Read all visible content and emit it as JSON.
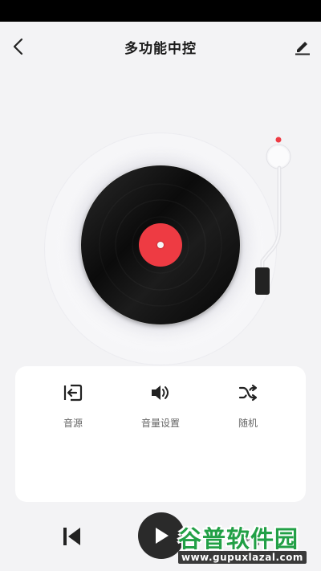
{
  "header": {
    "title": "多功能中控",
    "back_icon": "chevron-left-icon",
    "edit_icon": "pencil-icon"
  },
  "player": {
    "label_color": "#ee3b43",
    "record_color": "#111111"
  },
  "panel": {
    "items": [
      {
        "label": "音源",
        "icon": "input-source-icon"
      },
      {
        "label": "音量设置",
        "icon": "volume-icon"
      },
      {
        "label": "随机",
        "icon": "shuffle-icon"
      }
    ]
  },
  "playback": {
    "prev_icon": "skip-previous-icon",
    "play_icon": "play-icon",
    "next_icon": "skip-next-icon"
  },
  "watermark": {
    "name": "谷普软件园",
    "url": "www.gupuxlazal.com",
    "color": "#22a046"
  }
}
